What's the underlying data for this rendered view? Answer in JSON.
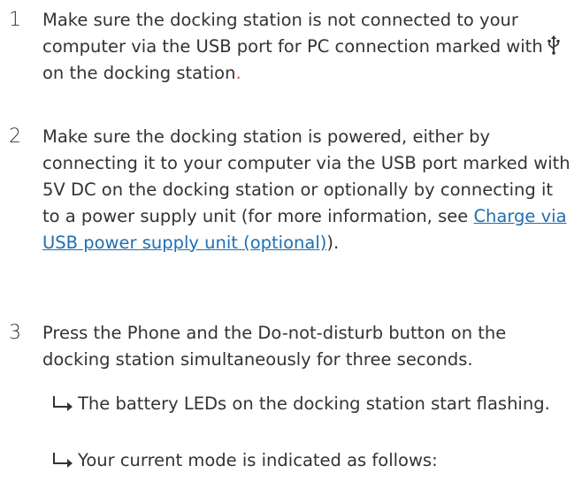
{
  "steps": [
    {
      "number": "1",
      "text_before_icon": "Make sure the docking station is not connected to your computer via the USB port for PC connection marked with",
      "icon": "usb-icon",
      "text_after_icon": "on the docking station",
      "period": "."
    },
    {
      "number": "2",
      "text_before_link": "Make sure the docking station is powered, either by connecting it to your computer via the USB port marked with 5V DC on the docking station or optionally by connecting it to a power supply unit (for more information, see",
      "link_text": "Charge via USB power supply unit (optional)",
      "text_after_link": ")."
    },
    {
      "number": "3",
      "text": "Press the Phone and the Do-not-disturb button on the docking station simultaneously for three seconds."
    }
  ],
  "results": [
    {
      "text": "The battery LEDs on the docking station start flashing."
    },
    {
      "text": "Your current mode is indicated as follows:"
    }
  ],
  "colors": {
    "text": "#333333",
    "link": "#1f6fb2",
    "period": "#c2643a"
  }
}
